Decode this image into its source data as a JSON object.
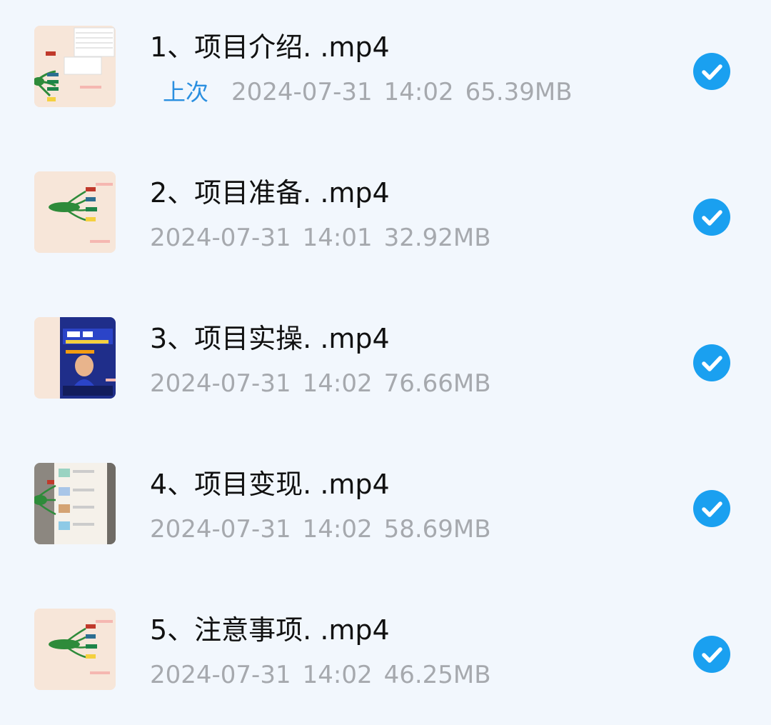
{
  "files": [
    {
      "name": "1、项目介绍. .mp4",
      "badge": "上次",
      "date": "2024-07-31",
      "time": "14:02",
      "size": "65.39MB",
      "thumb": "mindmap-table",
      "selected": true
    },
    {
      "name": "2、项目准备. .mp4",
      "badge": "",
      "date": "2024-07-31",
      "time": "14:01",
      "size": "32.92MB",
      "thumb": "mindmap",
      "selected": true
    },
    {
      "name": "3、项目实操. .mp4",
      "badge": "",
      "date": "2024-07-31",
      "time": "14:02",
      "size": "76.66MB",
      "thumb": "phone-poster",
      "selected": true
    },
    {
      "name": "4、项目变现. .mp4",
      "badge": "",
      "date": "2024-07-31",
      "time": "14:02",
      "size": "58.69MB",
      "thumb": "mindmap-screenshots",
      "selected": true
    },
    {
      "name": "5、注意事项. .mp4",
      "badge": "",
      "date": "2024-07-31",
      "time": "14:02",
      "size": "46.25MB",
      "thumb": "mindmap",
      "selected": true
    }
  ],
  "colors": {
    "background": "#f2f7fd",
    "check": "#1aa0f0",
    "badge": "#2a8fe0",
    "meta": "#a6a9ae",
    "title": "#111111"
  }
}
